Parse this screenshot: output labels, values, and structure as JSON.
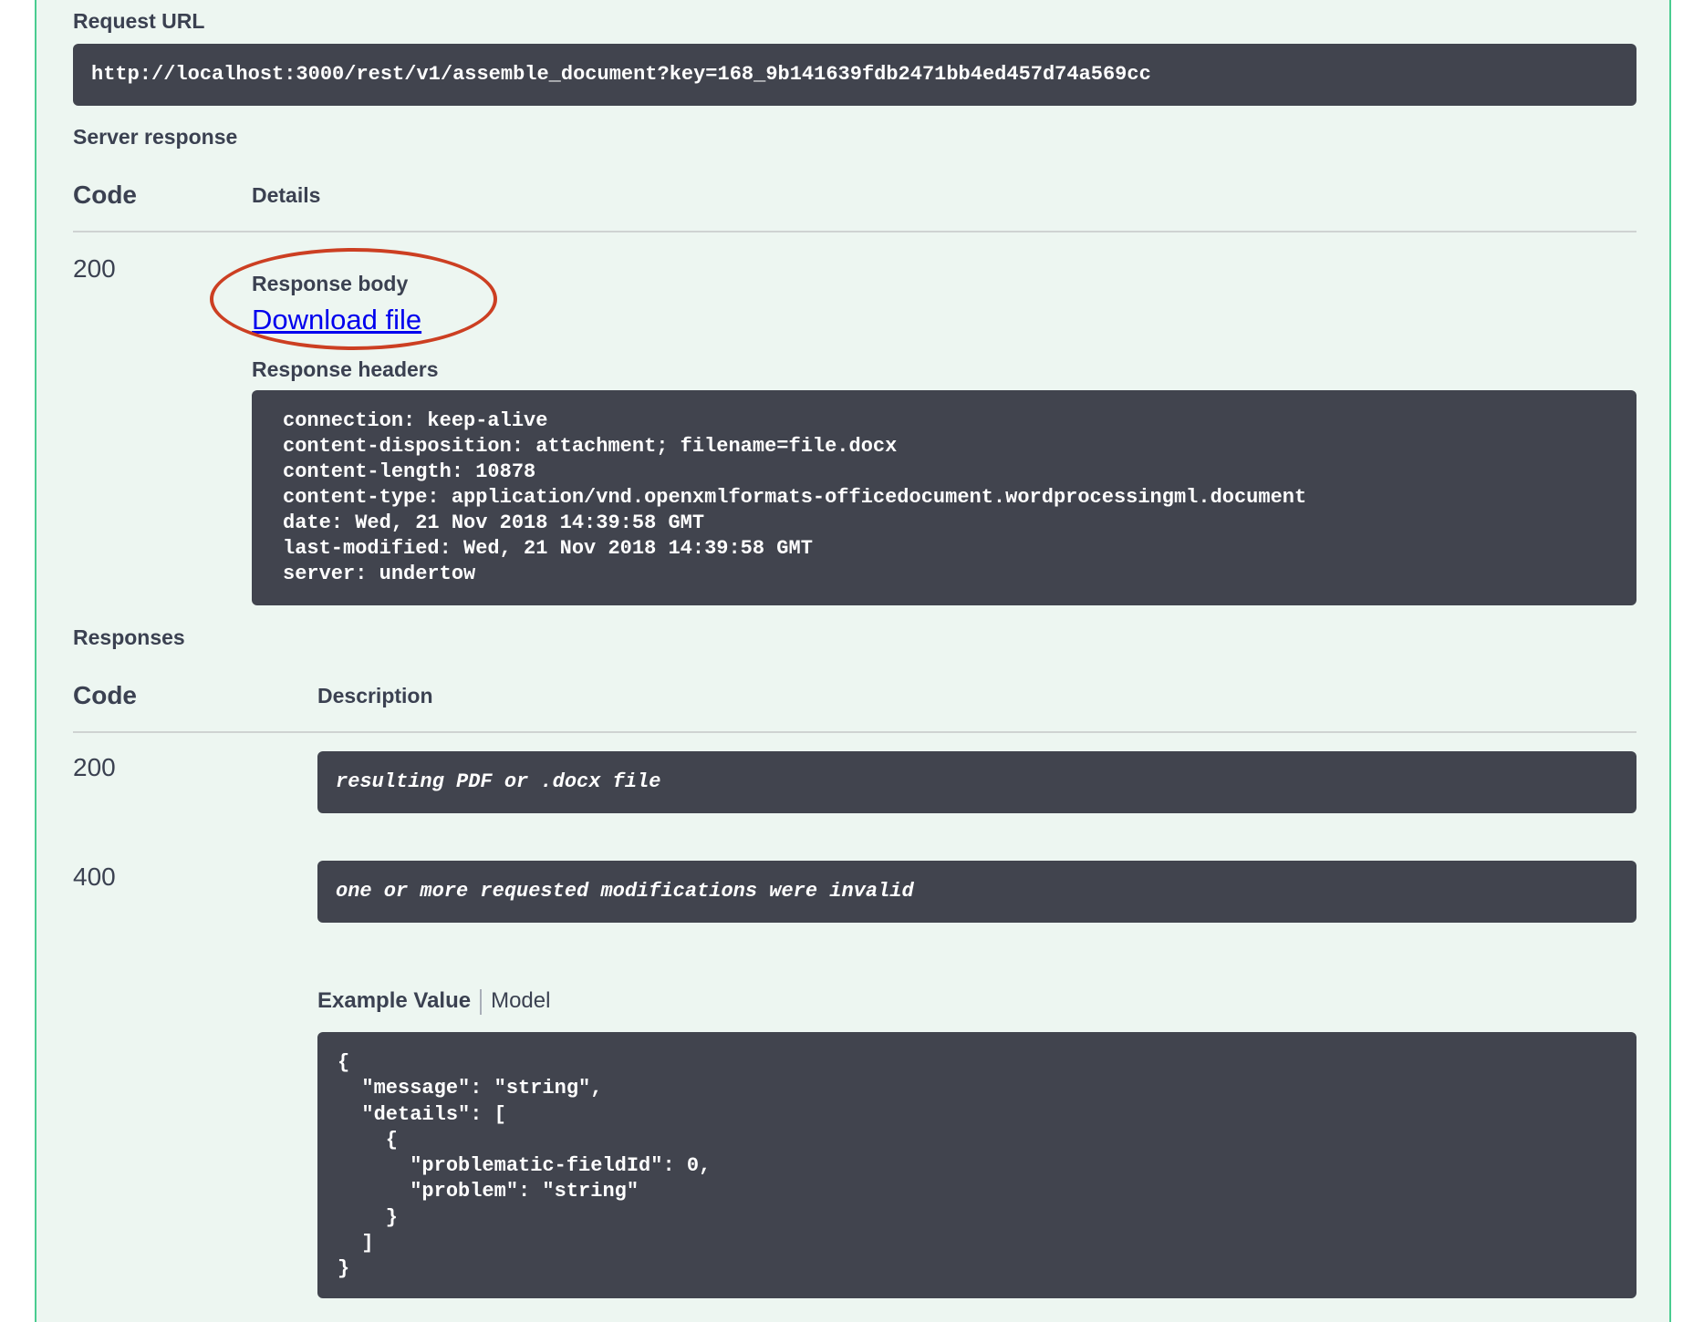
{
  "request_url": {
    "label": "Request URL",
    "value": "http://localhost:3000/rest/v1/assemble_document?key=168_9b141639fdb2471bb4ed457d74a569cc"
  },
  "server_response": {
    "label": "Server response",
    "col_code": "Code",
    "col_details": "Details",
    "code": "200",
    "body_label": "Response body",
    "download_link": "Download file",
    "headers_label": "Response headers",
    "headers": [
      "connection: keep-alive",
      "content-disposition: attachment; filename=file.docx",
      "content-length: 10878",
      "content-type: application/vnd.openxmlformats-officedocument.wordprocessingml.document",
      "date: Wed, 21 Nov 2018 14:39:58 GMT",
      "last-modified: Wed, 21 Nov 2018 14:39:58 GMT",
      "server: undertow"
    ]
  },
  "responses": {
    "label": "Responses",
    "col_code": "Code",
    "col_description": "Description",
    "items": [
      {
        "code": "200",
        "description": "resulting PDF or .docx file"
      },
      {
        "code": "400",
        "description": "one or more requested modifications were invalid"
      }
    ],
    "example_tab": "Example Value",
    "model_tab": "Model",
    "example_json": [
      "{",
      "  \"message\": \"string\",",
      "  \"details\": [",
      "    {",
      "      \"problematic-fieldId\": 0,",
      "      \"problem\": \"string\"",
      "    }",
      "  ]",
      "}"
    ]
  },
  "colors": {
    "panel_bg": "#edf6f1",
    "panel_border": "#49cc90",
    "code_box_bg": "#41444e",
    "highlight": "#cc3f22",
    "link": "#0000ee"
  }
}
